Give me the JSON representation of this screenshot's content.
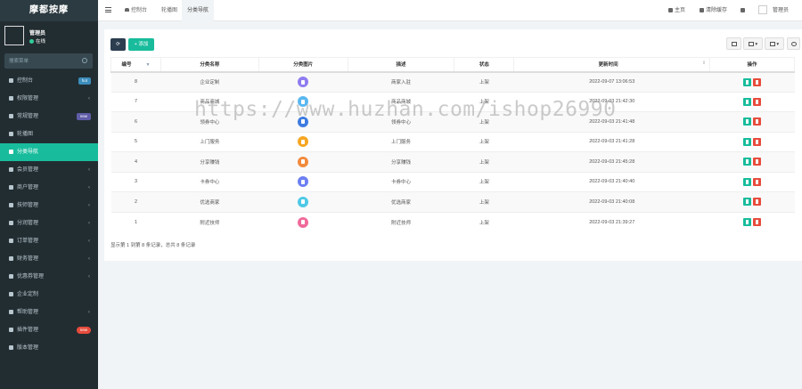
{
  "app": {
    "logo": "摩都按摩",
    "user": {
      "name": "管理员",
      "status": "在线"
    },
    "search": {
      "placeholder": "搜索菜单"
    },
    "nav": [
      {
        "label": "控制台",
        "badge": "hot",
        "badge_color": "#3c8dbc",
        "caret": false,
        "active": false
      },
      {
        "label": "权限管理",
        "badge": "",
        "caret": true,
        "active": false
      },
      {
        "label": "常规管理",
        "badge": "new",
        "badge_color": "#605ca8",
        "caret": false,
        "active": false
      },
      {
        "label": "轮播图",
        "badge": "",
        "caret": false,
        "active": false
      },
      {
        "label": "分类导航",
        "badge": "",
        "caret": false,
        "active": true
      },
      {
        "label": "会员管理",
        "badge": "",
        "caret": true,
        "active": false
      },
      {
        "label": "商户管理",
        "badge": "",
        "caret": true,
        "active": false
      },
      {
        "label": "技师管理",
        "badge": "",
        "caret": true,
        "active": false
      },
      {
        "label": "分润管理",
        "badge": "",
        "caret": true,
        "active": false
      },
      {
        "label": "订单管理",
        "badge": "",
        "caret": true,
        "active": false
      },
      {
        "label": "财务管理",
        "badge": "",
        "caret": true,
        "active": false
      },
      {
        "label": "优惠券管理",
        "badge": "",
        "caret": true,
        "active": false
      },
      {
        "label": "企业定制",
        "badge": "",
        "caret": false,
        "active": false
      },
      {
        "label": "帮助管理",
        "badge": "",
        "caret": true,
        "active": false
      },
      {
        "label": "插件管理",
        "badge": "new",
        "badge_color": "#e74c3c",
        "caret": false,
        "active": false
      },
      {
        "label": "版本管理",
        "badge": "",
        "caret": false,
        "active": false
      }
    ]
  },
  "topbar": {
    "tabs": [
      "控制台",
      "轮播图",
      "分类导航"
    ],
    "home": "主页",
    "clear_cache": "清除缓存",
    "admin": "管理员"
  },
  "toolbar": {
    "add_label": "添加"
  },
  "table": {
    "headers": [
      "编号",
      "分类名称",
      "分类图片",
      "描述",
      "状态",
      "更新时间",
      "操作"
    ],
    "rows": [
      {
        "id": "8",
        "name": "企业定制",
        "icon_color": "#8e7cf0",
        "desc": "商家入驻",
        "status": "上架",
        "time": "2022-09-07 13:06:53"
      },
      {
        "id": "7",
        "name": "商品商城",
        "icon_color": "#5ab7f0",
        "desc": "商品商城",
        "status": "上架",
        "time": "2022-09-03 21:42:30"
      },
      {
        "id": "6",
        "name": "领券中心",
        "icon_color": "#3d7be0",
        "desc": "领券中心",
        "status": "上架",
        "time": "2022-09-03 21:41:48"
      },
      {
        "id": "5",
        "name": "上门服务",
        "icon_color": "#f5a623",
        "desc": "上门服务",
        "status": "上架",
        "time": "2022-09-03 21:41:28"
      },
      {
        "id": "4",
        "name": "分享赚钱",
        "icon_color": "#f28a3c",
        "desc": "分享赚钱",
        "status": "上架",
        "time": "2022-09-03 21:45:28"
      },
      {
        "id": "3",
        "name": "卡券中心",
        "icon_color": "#6c7ff2",
        "desc": "卡券中心",
        "status": "上架",
        "time": "2022-09-03 21:40:40"
      },
      {
        "id": "2",
        "name": "优选商家",
        "icon_color": "#4ec9e6",
        "desc": "优选商家",
        "status": "上架",
        "time": "2022-09-03 21:40:08"
      },
      {
        "id": "1",
        "name": "附近技师",
        "icon_color": "#ef6a9a",
        "desc": "附近技师",
        "status": "上架",
        "time": "2022-09-03 21:39:27"
      }
    ]
  },
  "pager": {
    "summary": "显示第 1 到第 8 条记录，总共 8 条记录"
  },
  "watermark": "https://www.huzhan.com/ishop26990"
}
